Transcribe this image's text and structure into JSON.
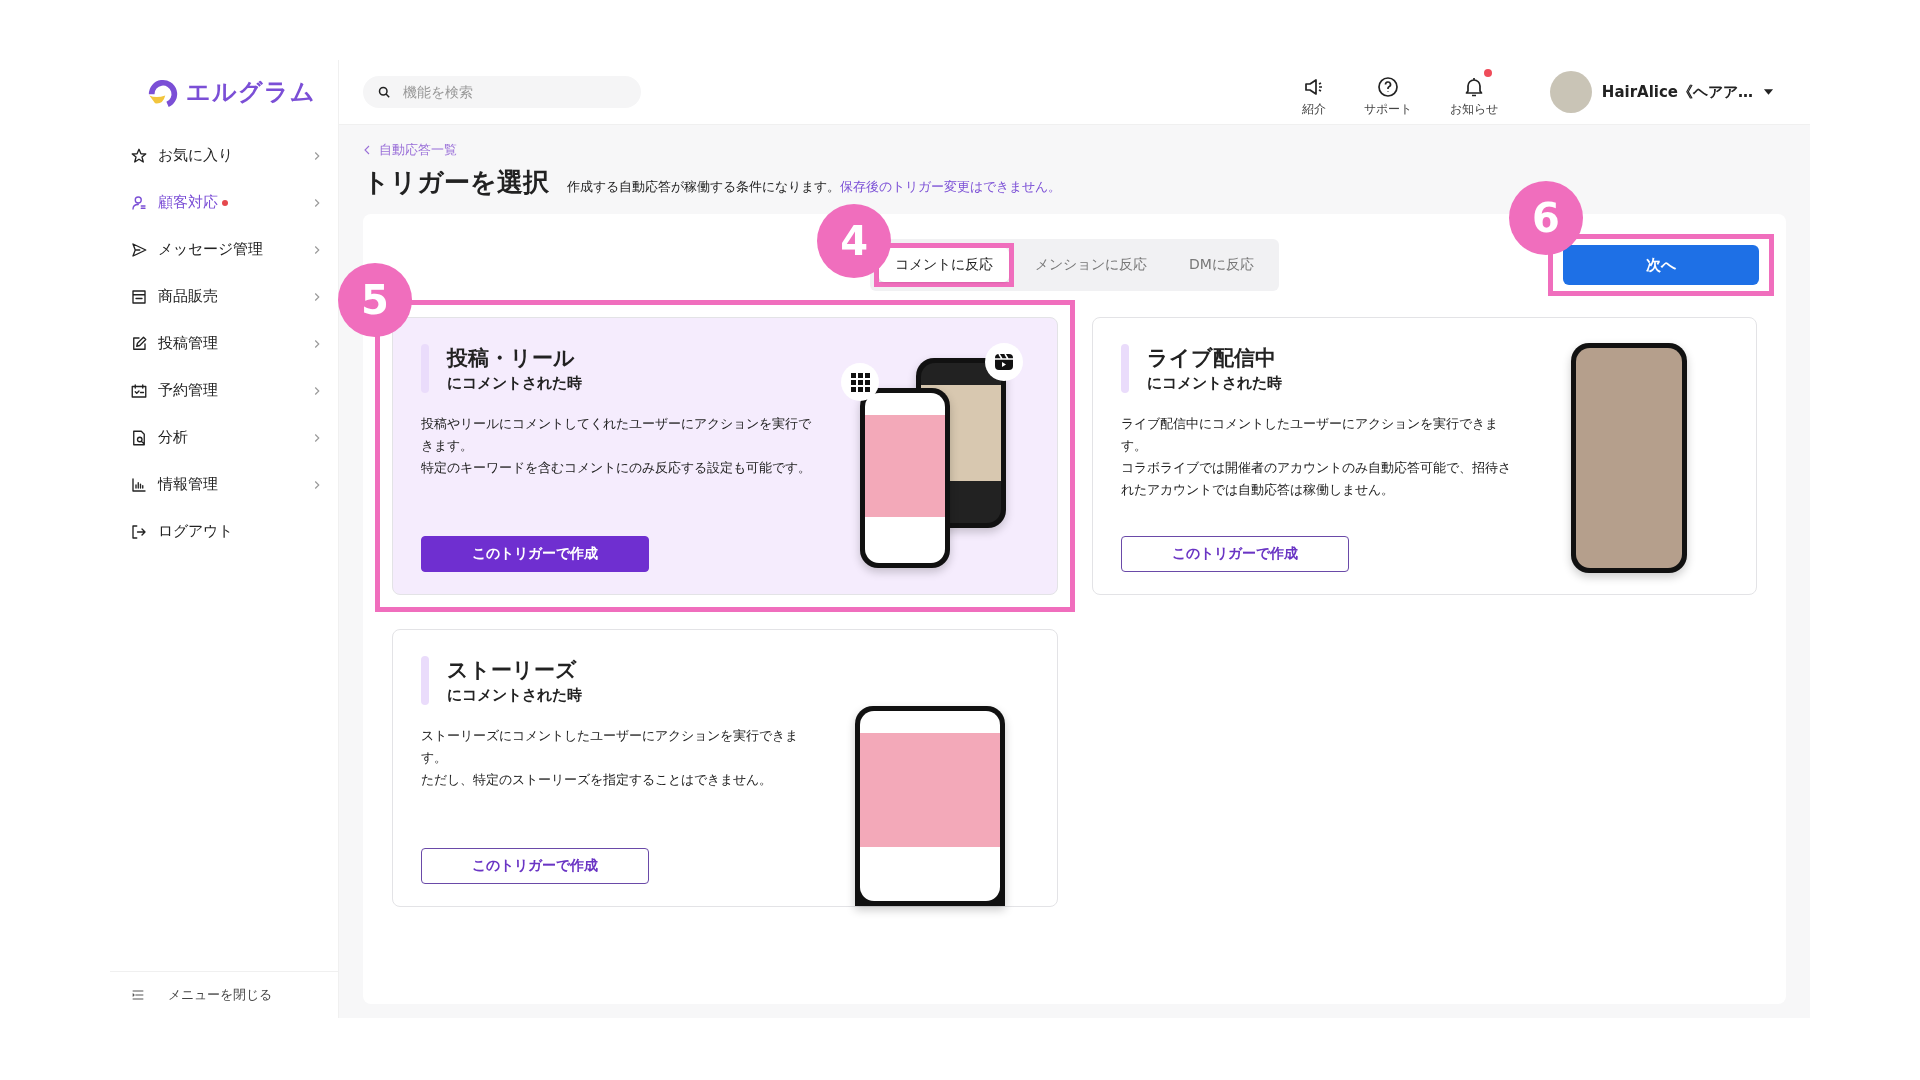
{
  "logo": {
    "text": "エルグラム"
  },
  "search": {
    "placeholder": "機能を検索"
  },
  "header_actions": [
    {
      "label": "紹介",
      "kind": "megaphone",
      "badge": false
    },
    {
      "label": "サポート",
      "kind": "help",
      "badge": false
    },
    {
      "label": "お知らせ",
      "kind": "bell",
      "badge": true
    }
  ],
  "user": {
    "name": "HairAlice《ヘアア…"
  },
  "sidebar": {
    "items": [
      {
        "label": "お気に入り",
        "kind": "star",
        "selected": false,
        "dot": false
      },
      {
        "label": "顧客対応",
        "kind": "user",
        "selected": true,
        "dot": true
      },
      {
        "label": "メッセージ管理",
        "kind": "send",
        "selected": false,
        "dot": false
      },
      {
        "label": "商品販売",
        "kind": "store",
        "selected": false,
        "dot": false
      },
      {
        "label": "投稿管理",
        "kind": "edit",
        "selected": false,
        "dot": false
      },
      {
        "label": "予約管理",
        "kind": "calendar",
        "selected": false,
        "dot": false
      },
      {
        "label": "分析",
        "kind": "analysis",
        "selected": false,
        "dot": false
      },
      {
        "label": "情報管理",
        "kind": "chart",
        "selected": false,
        "dot": false
      },
      {
        "label": "ログアウト",
        "kind": "logout",
        "selected": false,
        "dot": false
      }
    ],
    "collapse": "メニューを閉じる"
  },
  "breadcrumb": "自動応答一覧",
  "title": "トリガーを選択",
  "description": {
    "text": "作成する自動応答が稼働する条件になります。",
    "link": "保存後のトリガー変更はできません。"
  },
  "tabs": [
    {
      "label": "コメントに反応",
      "selected": true,
      "callout": "4"
    },
    {
      "label": "メンションに反応",
      "selected": false
    },
    {
      "label": "DMに反応",
      "selected": false
    }
  ],
  "next_button": {
    "label": "次へ",
    "callout": "6"
  },
  "cards": [
    {
      "title": "投稿・リール",
      "subtitle": "にコメントされた時",
      "paragraphs": [
        "投稿やリールにコメントしてくれたユーザーにアクションを実行できます。",
        "特定のキーワードを含むコメントにのみ反応する設定も可能です。"
      ],
      "button": "このトリガーで作成",
      "selected": true,
      "callout": "5",
      "kind": "post"
    },
    {
      "title": "ライブ配信中",
      "subtitle": "にコメントされた時",
      "paragraphs": [
        "ライブ配信中にコメントしたユーザーにアクションを実行できます。",
        "コラボライブでは開催者のアカウントのみ自動応答可能で、招待されたアカウントでは自動応答は稼働しません。"
      ],
      "button": "このトリガーで作成",
      "selected": false,
      "kind": "live"
    },
    {
      "title": "ストーリーズ",
      "subtitle": "にコメントされた時",
      "paragraphs": [
        "ストーリーズにコメントしたユーザーにアクションを実行できます。",
        "ただし、特定のストーリーズを指定することはできません。"
      ],
      "button": "このトリガーで作成",
      "selected": false,
      "kind": "story"
    }
  ]
}
